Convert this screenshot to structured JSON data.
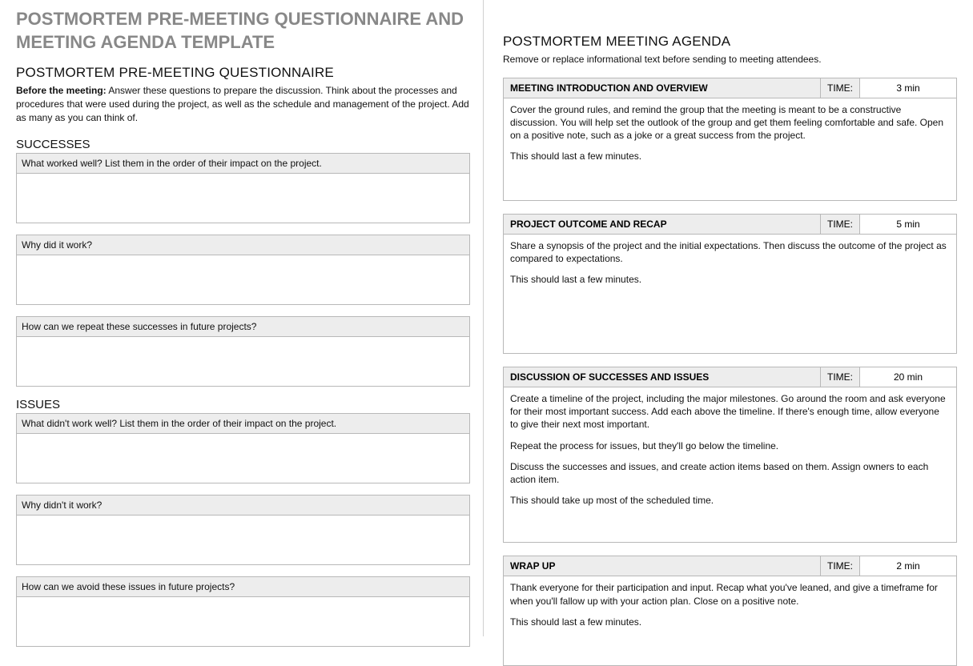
{
  "left": {
    "main_title": "POSTMORTEM PRE-MEETING QUESTIONNAIRE AND MEETING AGENDA TEMPLATE",
    "section_title": "POSTMORTEM PRE-MEETING QUESTIONNAIRE",
    "intro_bold": "Before the meeting:",
    "intro_rest": " Answer these questions to prepare the discussion. Think about the processes and procedures that were used during the project, as well as the schedule and management of the project. Add as many as you can think of.",
    "successes": {
      "heading": "SUCCESSES",
      "q1": "What worked well? List them in the order of their impact on the project.",
      "q2": "Why did it work?",
      "q3": "How can we repeat these successes in future projects?"
    },
    "issues": {
      "heading": "ISSUES",
      "q1": "What didn't work well? List them in the order of their impact on the project.",
      "q2": "Why didn't it work?",
      "q3": "How can we avoid these issues in future projects?"
    }
  },
  "right": {
    "section_title": "POSTMORTEM MEETING AGENDA",
    "subtitle": "Remove or replace informational text before sending to meeting attendees.",
    "time_label": "TIME:",
    "items": [
      {
        "title": "MEETING INTRODUCTION AND OVERVIEW",
        "time": "3 min",
        "p1": "Cover the ground rules, and remind the group that the meeting is meant to be a constructive discussion. You will help set the outlook of the group and get them feeling comfortable and safe. Open on a positive note, such as a joke or a great success from the project.",
        "p2": "This should last a few minutes.",
        "filler": "filler"
      },
      {
        "title": "PROJECT OUTCOME AND RECAP",
        "time": "5 min",
        "p1": "Share a synopsis of the project and the initial expectations. Then discuss the outcome of the project as compared to expectations.",
        "p2": "This should last a few minutes.",
        "filler": "filler-lg"
      },
      {
        "title": "DISCUSSION OF SUCCESSES AND ISSUES",
        "time": "20 min",
        "p1": "Create a timeline of the project, including the major milestones. Go around the room and ask everyone for their most important success. Add each above the timeline. If there's enough time, allow everyone to give their next most important.",
        "p2": "Repeat the process for issues, but they'll go below the timeline.",
        "p3": "Discuss the successes and issues, and create action items based on them. Assign owners to each action item.",
        "p4": "This should take up most of the scheduled time.",
        "filler": "filler-md"
      },
      {
        "title": "WRAP UP",
        "time": "2 min",
        "p1": "Thank everyone for their participation and input. Recap what you've leaned, and give a timeframe for when you'll fallow up with your action plan. Close on a positive note.",
        "p2": "This should last a few minutes.",
        "filler": "filler"
      }
    ]
  }
}
